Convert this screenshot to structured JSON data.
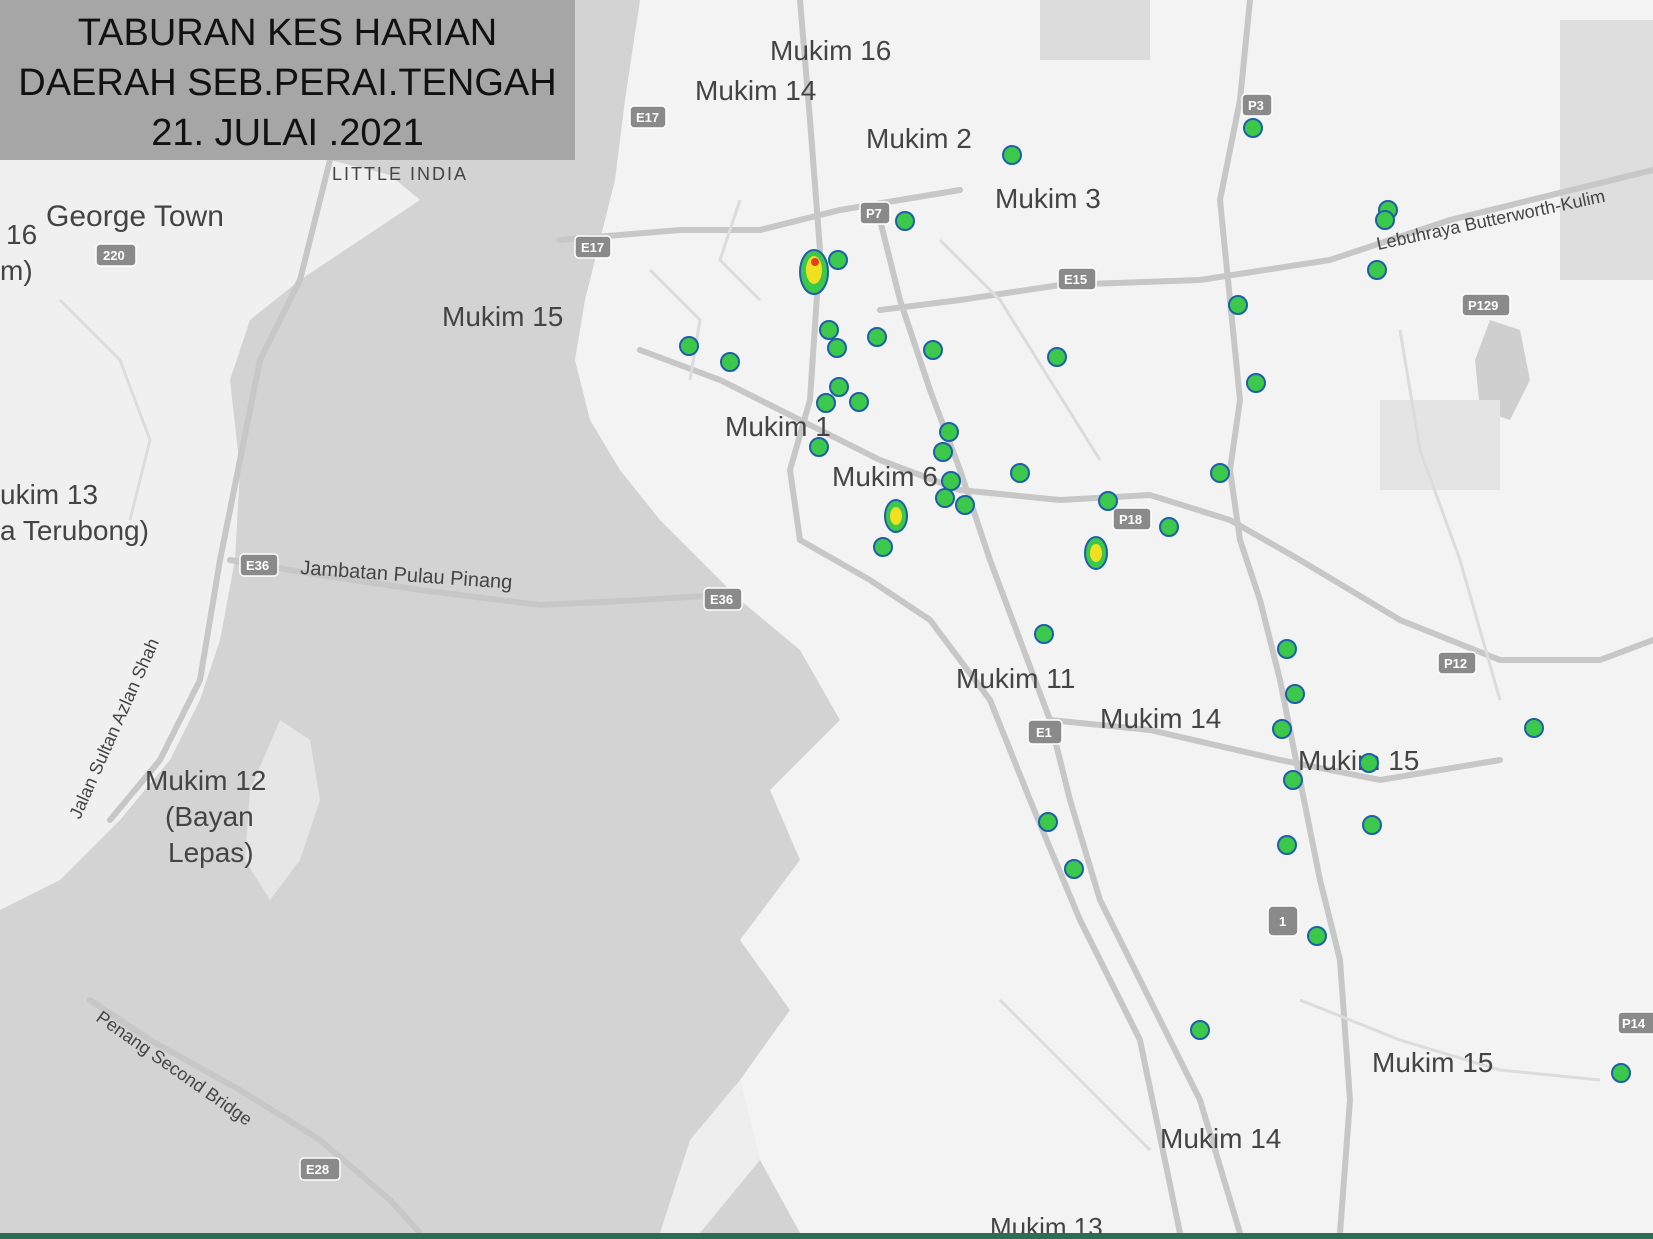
{
  "title": {
    "line1": "TABURAN KES HARIAN",
    "line2": "DAERAH SEB.PERAI.TENGAH",
    "line3": "21. JULAI .2021"
  },
  "colors": {
    "land": "#f3f3f3",
    "water": "#d3d3d3",
    "road": "#c7c7c7",
    "title_bg": "#a6a6a6",
    "case_point": "#3cc84a",
    "case_point_edge": "#1d5fa8",
    "hotspot": "#f0e020",
    "hotspot_core": "#e0401a",
    "bottom_bar": "#2f6b55"
  },
  "labels": [
    {
      "id": "mukim16-top",
      "text": "Mukim 16"
    },
    {
      "id": "mukim14-top",
      "text": "Mukim 14"
    },
    {
      "id": "mukim2",
      "text": "Mukim 2"
    },
    {
      "id": "mukim3",
      "text": "Mukim 3"
    },
    {
      "id": "little-india",
      "text": "LITTLE INDIA"
    },
    {
      "id": "george-town",
      "text": "George Town"
    },
    {
      "id": "left-16",
      "text": "16"
    },
    {
      "id": "left-m",
      "text": "m)"
    },
    {
      "id": "mukim15-w",
      "text": "Mukim 15"
    },
    {
      "id": "mukim1",
      "text": "Mukim 1"
    },
    {
      "id": "mukim6",
      "text": "Mukim 6"
    },
    {
      "id": "mukim13-w",
      "text": "ukim 13"
    },
    {
      "id": "terubong",
      "text": "a Terubong)"
    },
    {
      "id": "jambatan",
      "text": "Jambatan Pulau Pinang"
    },
    {
      "id": "jalan-sultan",
      "text": "Jalan Sultan Azlan Shah"
    },
    {
      "id": "mukim12",
      "text": "Mukim 12"
    },
    {
      "id": "bayan",
      "text": "(Bayan"
    },
    {
      "id": "lepas",
      "text": "Lepas)"
    },
    {
      "id": "second-bridge",
      "text": "Penang Second Bridge"
    },
    {
      "id": "mukim11",
      "text": "Mukim 11"
    },
    {
      "id": "mukim14-mid",
      "text": "Mukim 14"
    },
    {
      "id": "mukim15-mid",
      "text": "Mukim 15"
    },
    {
      "id": "lebuhraya",
      "text": "Lebuhraya Butterworth-Kulim"
    },
    {
      "id": "mukim15-se",
      "text": "Mukim 15"
    },
    {
      "id": "mukim14-s",
      "text": "Mukim 14"
    },
    {
      "id": "mukim13-s",
      "text": "Mukim 13"
    }
  ],
  "shields": [
    {
      "id": "e17-a",
      "text": "E17"
    },
    {
      "id": "e17-b",
      "text": "E17"
    },
    {
      "id": "p7",
      "text": "P7"
    },
    {
      "id": "p3",
      "text": "P3"
    },
    {
      "id": "e15",
      "text": "E15"
    },
    {
      "id": "p129",
      "text": "P129"
    },
    {
      "id": "r220",
      "text": "220"
    },
    {
      "id": "e36-a",
      "text": "E36"
    },
    {
      "id": "e36-b",
      "text": "E36"
    },
    {
      "id": "p18",
      "text": "P18"
    },
    {
      "id": "p12",
      "text": "P12"
    },
    {
      "id": "e1",
      "text": "E1"
    },
    {
      "id": "r1",
      "text": "1"
    },
    {
      "id": "e28",
      "text": "E28"
    },
    {
      "id": "p14",
      "text": "P14"
    }
  ]
}
